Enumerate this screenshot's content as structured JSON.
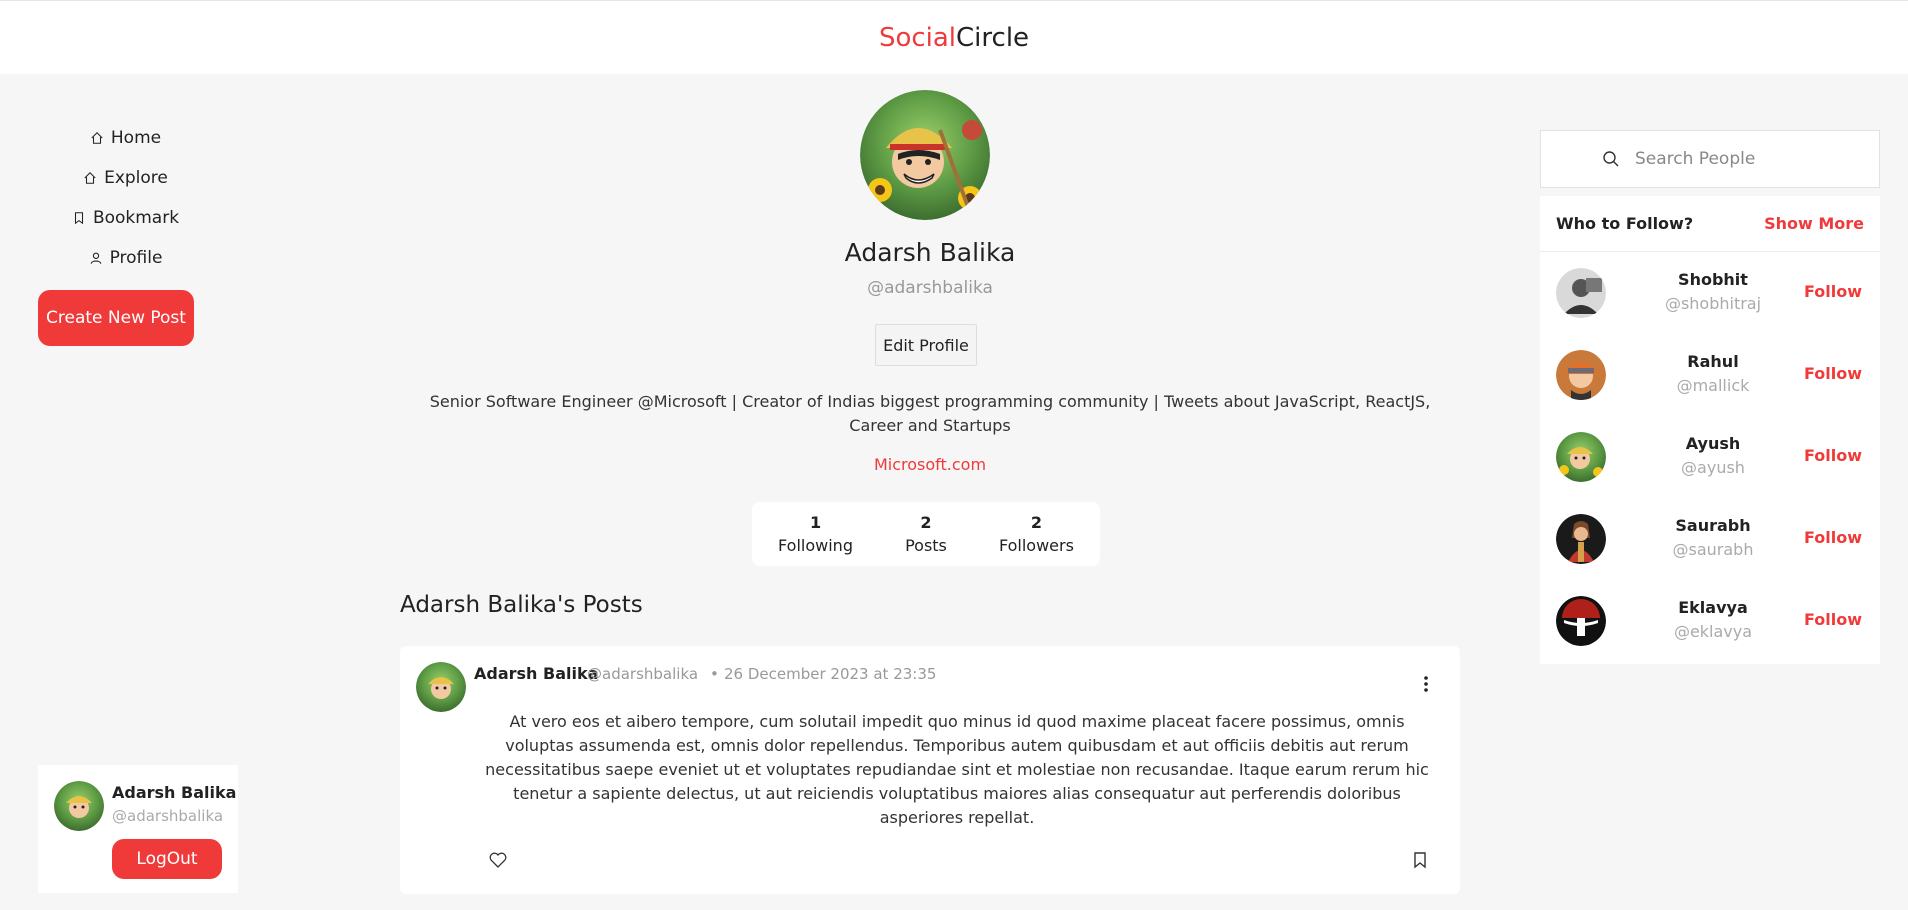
{
  "header": {
    "brand_accent": "Social",
    "brand_rest": "Circle"
  },
  "nav": {
    "items": [
      {
        "label": "Home",
        "icon": "home-icon"
      },
      {
        "label": "Explore",
        "icon": "explore-icon"
      },
      {
        "label": "Bookmark",
        "icon": "bookmark-icon"
      },
      {
        "label": "Profile",
        "icon": "user-icon"
      }
    ],
    "create_label": "Create New Post"
  },
  "user_card": {
    "name": "Adarsh Balika",
    "handle": "@adarshbalika",
    "logout_label": "LogOut"
  },
  "profile": {
    "name": "Adarsh Balika",
    "handle": "@adarshbalika",
    "edit_label": "Edit Profile",
    "bio": "Senior Software Engineer @Microsoft | Creator of Indias biggest programming community | Tweets about JavaScript, ReactJS, Career and Startups",
    "website": "Microsoft.com",
    "stats": [
      {
        "value": "1",
        "label": "Following"
      },
      {
        "value": "2",
        "label": "Posts"
      },
      {
        "value": "2",
        "label": "Followers"
      }
    ],
    "posts_title": "Adarsh Balika's Posts"
  },
  "post": {
    "author": "Adarsh Balika",
    "handle": "@adarshbalika",
    "separator": "•",
    "date": "26 December 2023 at 23:35",
    "body": "At vero eos et aibero tempore, cum solutail impedit quo minus id quod maxime placeat facere possimus, omnis voluptas assumenda est, omnis dolor repellendus. Temporibus autem quibusdam et aut officiis debitis aut rerum necessitatibus saepe eveniet ut et voluptates repudiandae sint et molestiae non recusandae. Itaque earum rerum hic tenetur a sapiente delectus, ut aut reiciendis voluptatibus maiores alias consequatur aut perferendis doloribus asperiores repellat."
  },
  "search": {
    "placeholder": "Search People"
  },
  "who_to_follow": {
    "title": "Who to Follow?",
    "show_more": "Show More",
    "follow_label": "Follow",
    "people": [
      {
        "name": "Shobhit",
        "handle": "@shobhitraj"
      },
      {
        "name": "Rahul",
        "handle": "@mallick"
      },
      {
        "name": "Ayush",
        "handle": "@ayush"
      },
      {
        "name": "Saurabh",
        "handle": "@saurabh"
      },
      {
        "name": "Eklavya",
        "handle": "@eklavya"
      }
    ]
  },
  "colors": {
    "accent": "#f03a3a",
    "background": "#f6f6f6"
  }
}
